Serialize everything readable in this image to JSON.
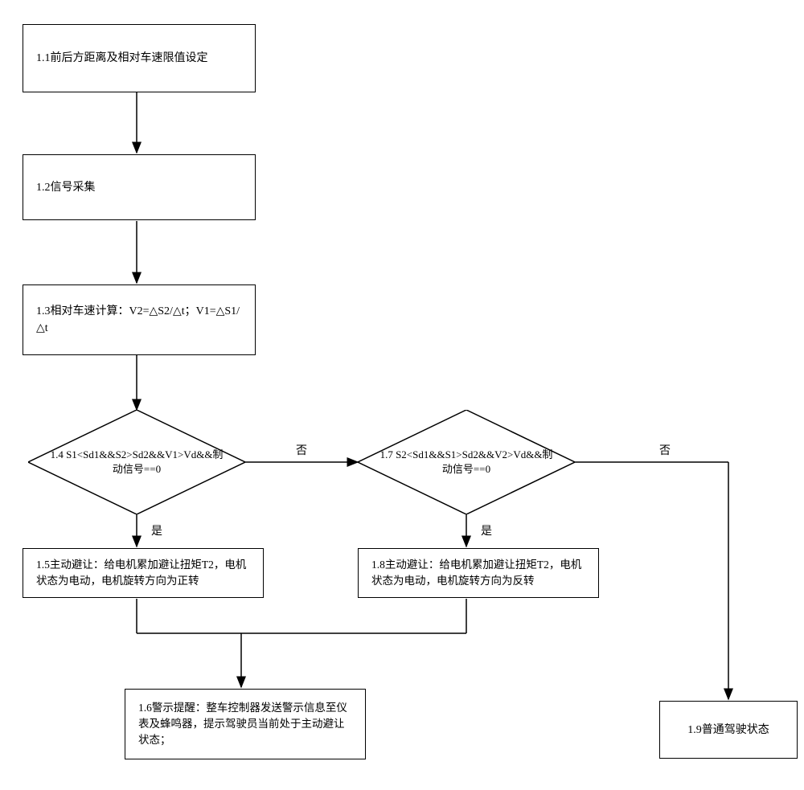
{
  "chart_data": {
    "type": "flowchart",
    "nodes": [
      {
        "id": "1.1",
        "type": "process",
        "text": "1.1前后方距离及相对车速限值设定"
      },
      {
        "id": "1.2",
        "type": "process",
        "text": "1.2信号采集"
      },
      {
        "id": "1.3",
        "type": "process",
        "text": "1.3相对车速计算：V2=△S2/△t；V1=△S1/△t"
      },
      {
        "id": "1.4",
        "type": "decision",
        "text": "1.4 S1<Sd1&&S2>Sd2&&V1>Vd&&制动信号==0"
      },
      {
        "id": "1.5",
        "type": "process",
        "text": "1.5主动避让：给电机累加避让扭矩T2，电机状态为电动，电机旋转方向为正转"
      },
      {
        "id": "1.6",
        "type": "process",
        "text": "1.6警示提醒：整车控制器发送警示信息至仪表及蜂鸣器，提示驾驶员当前处于主动避让状态；"
      },
      {
        "id": "1.7",
        "type": "decision",
        "text": "1.7 S2<Sd1&&S1>Sd2&&V2>Vd&&制动信号==0"
      },
      {
        "id": "1.8",
        "type": "process",
        "text": "1.8主动避让：给电机累加避让扭矩T2，电机状态为电动，电机旋转方向为反转"
      },
      {
        "id": "1.9",
        "type": "process",
        "text": "1.9普通驾驶状态"
      }
    ],
    "edges": [
      {
        "from": "1.1",
        "to": "1.2"
      },
      {
        "from": "1.2",
        "to": "1.3"
      },
      {
        "from": "1.3",
        "to": "1.4"
      },
      {
        "from": "1.4",
        "to": "1.5",
        "label": "是"
      },
      {
        "from": "1.4",
        "to": "1.7",
        "label": "否"
      },
      {
        "from": "1.5",
        "to": "1.6"
      },
      {
        "from": "1.7",
        "to": "1.8",
        "label": "是"
      },
      {
        "from": "1.7",
        "to": "1.9",
        "label": "否"
      },
      {
        "from": "1.8",
        "to": "1.6"
      }
    ],
    "labels": {
      "yes": "是",
      "no": "否"
    }
  },
  "boxes": {
    "b11": "1.1前后方距离及相对车速限值设定",
    "b12": "1.2信号采集",
    "b13": "1.3相对车速计算：V2=△S2/△t；V1=△S1/△t",
    "b14": "1.4 S1<Sd1&&S2>Sd2&&V1>Vd&&制动信号==0",
    "b15": "1.5主动避让：给电机累加避让扭矩T2，电机状态为电动，电机旋转方向为正转",
    "b16": "1.6警示提醒：整车控制器发送警示信息至仪表及蜂鸣器，提示驾驶员当前处于主动避让状态；",
    "b17": "1.7 S2<Sd1&&S1>Sd2&&V2>Vd&&制动信号==0",
    "b18": "1.8主动避让：给电机累加避让扭矩T2，电机状态为电动，电机旋转方向为反转",
    "b19": "1.9普通驾驶状态"
  },
  "labels": {
    "yes": "是",
    "no": "否"
  }
}
